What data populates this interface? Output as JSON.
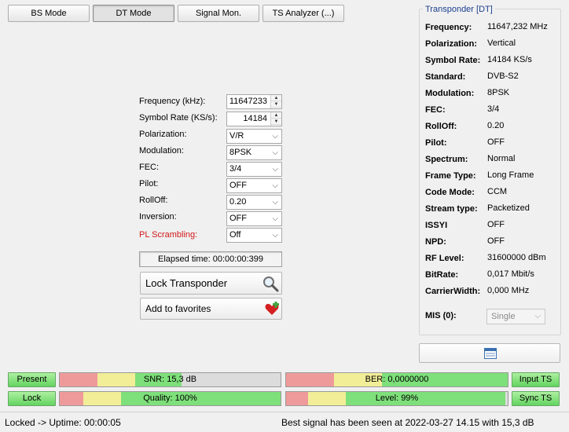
{
  "modes": [
    "BS Mode",
    "DT Mode",
    "Signal Mon.",
    "TS Analyzer (...)"
  ],
  "active_mode": "DT Mode",
  "form": {
    "frequency": {
      "label": "Frequency (kHz):",
      "value": "11647233"
    },
    "symbol_rate": {
      "label": "Symbol Rate (KS/s):",
      "value": "14184"
    },
    "polarization": {
      "label": "Polarization:",
      "value": "V/R"
    },
    "modulation": {
      "label": "Modulation:",
      "value": "8PSK"
    },
    "fec": {
      "label": "FEC:",
      "value": "3/4"
    },
    "pilot": {
      "label": "Pilot:",
      "value": "OFF"
    },
    "rolloff": {
      "label": "RollOff:",
      "value": "0.20"
    },
    "inversion": {
      "label": "Inversion:",
      "value": "OFF"
    },
    "pl_scrambling": {
      "label": "PL Scrambling:",
      "value": "Off"
    }
  },
  "elapsed": "Elapsed time: 00:00:00:399",
  "lock_transponder": "Lock Transponder",
  "add_favorites": "Add to favorites",
  "transponder": {
    "title": "Transponder [DT]",
    "rows": [
      {
        "label": "Frequency:",
        "value": "11647,232 MHz"
      },
      {
        "label": "Polarization:",
        "value": "Vertical"
      },
      {
        "label": "Symbol Rate:",
        "value": "14184 KS/s"
      },
      {
        "label": "Standard:",
        "value": "DVB-S2"
      },
      {
        "label": "Modulation:",
        "value": "8PSK"
      },
      {
        "label": "FEC:",
        "value": "3/4"
      },
      {
        "label": "RollOff:",
        "value": "0.20"
      },
      {
        "label": "Pilot:",
        "value": "OFF"
      },
      {
        "label": "Spectrum:",
        "value": "Normal"
      },
      {
        "label": "Frame Type:",
        "value": "Long Frame"
      },
      {
        "label": "Code Mode:",
        "value": "CCM"
      },
      {
        "label": "Stream type:",
        "value": "Packetized"
      },
      {
        "label": "ISSYI",
        "value": "OFF"
      },
      {
        "label": "NPD:",
        "value": "OFF"
      },
      {
        "label": "RF Level:",
        "value": "31600000 dBm"
      },
      {
        "label": "BitRate:",
        "value": "0,017 Mbit/s"
      },
      {
        "label": "CarrierWidth:",
        "value": "0,000 MHz"
      }
    ],
    "mis_label": "MIS (0):",
    "mis_value": "Single"
  },
  "status": {
    "present": "Present",
    "lock": "Lock",
    "input_ts": "Input TS",
    "sync_ts": "Sync TS",
    "snr": {
      "text": "SNR: 15,3 dB",
      "level": 0.55
    },
    "ber": {
      "text": "BER: 0,0000000",
      "level": 1.0
    },
    "quality": {
      "text": "Quality: 100%",
      "level": 1.0
    },
    "signal_level": {
      "text": "Level: 99%",
      "level": 0.99
    }
  },
  "statusbar": {
    "left": "Locked -> Uptime: 00:00:05",
    "right": "Best signal has been seen at 2022-03-27 14.15 with 15,3 dB"
  },
  "colors": {
    "meter_red": "#ef9a9a",
    "meter_yellow": "#f2ee98",
    "meter_green": "#7ee07a",
    "accent_blue": "#1b3f8f",
    "warning_red": "#d01818"
  },
  "icons": {
    "search": "magnifier-icon",
    "favorite": "heart-plus-icon",
    "list": "list-view-icon"
  }
}
